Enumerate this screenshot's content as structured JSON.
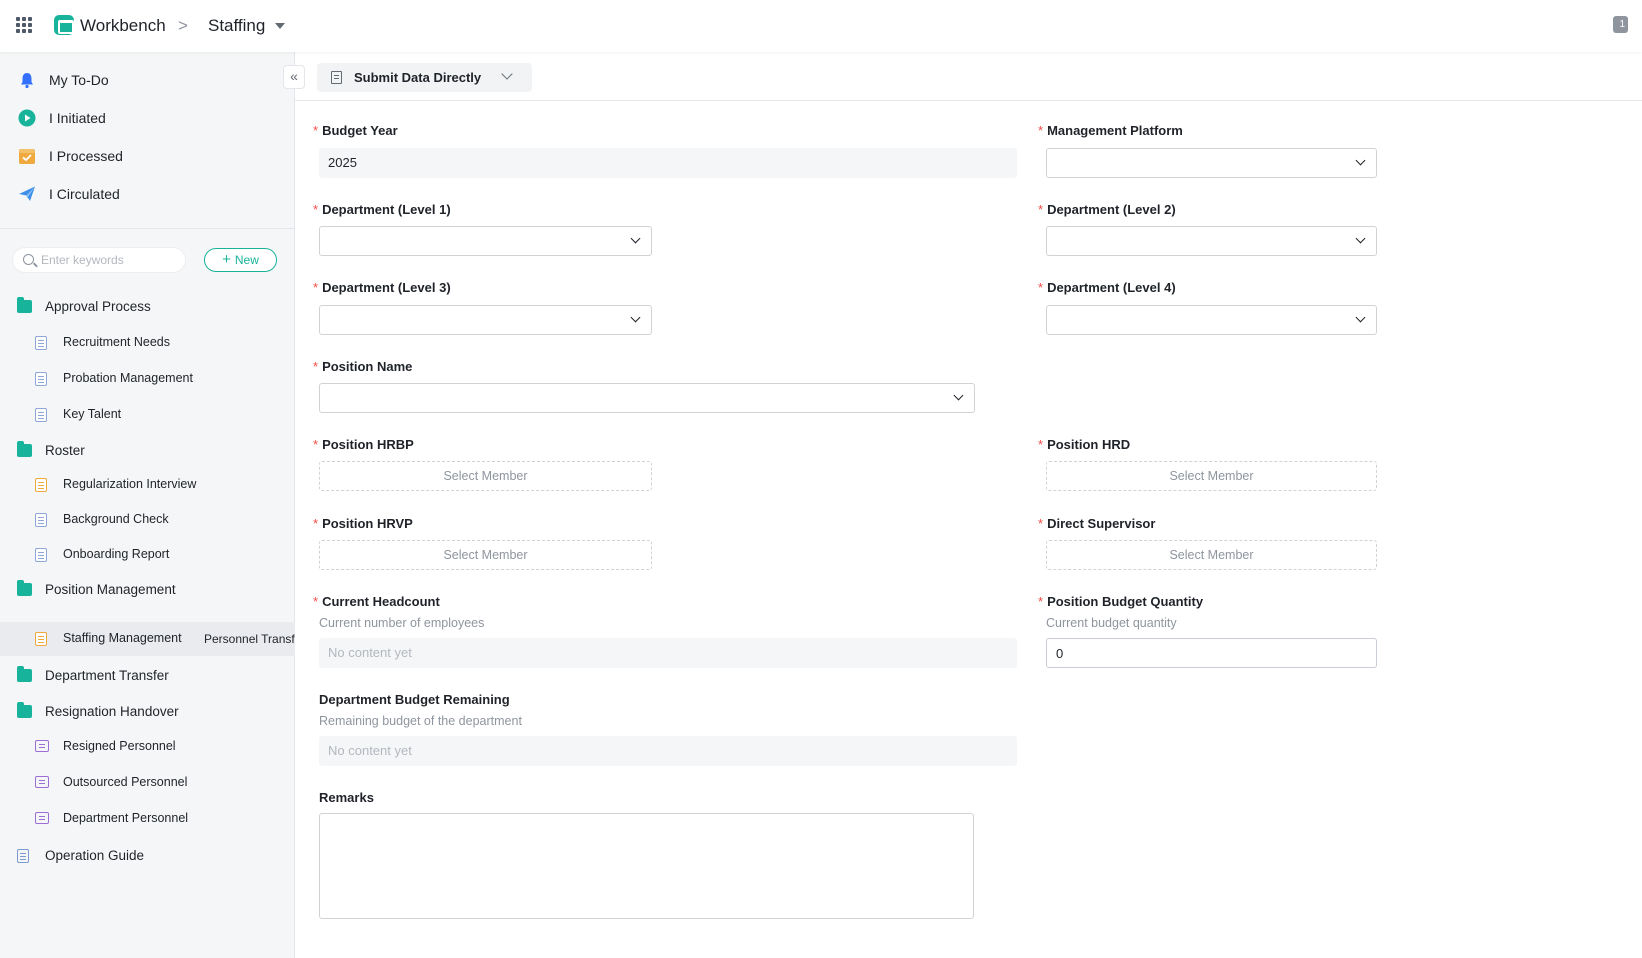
{
  "header": {
    "app_title": "Workbench",
    "breadcrumb_separator": ">",
    "current_section": "Staffing",
    "notification_count": "1"
  },
  "sidebar": {
    "quick_items": [
      {
        "label": "My To-Do",
        "icon": "bell-icon",
        "color": "#3370ff"
      },
      {
        "label": "I Initiated",
        "icon": "play-icon",
        "color": "#18b39b"
      },
      {
        "label": "I Processed",
        "icon": "checkbox-icon",
        "color": "#f0a93e"
      },
      {
        "label": "I Circulated",
        "icon": "paper-plane-icon",
        "color": "#3d8fe8"
      }
    ],
    "search_placeholder": "Enter keywords",
    "new_label": "New",
    "tree": {
      "approval_process": "Approval Process",
      "recruitment_needs": "Recruitment Needs",
      "probation_management": "Probation Management",
      "key_talent": "Key Talent",
      "roster": "Roster",
      "regularization_interview": "Regularization Interview",
      "background_check": "Background Check",
      "onboarding_report": "Onboarding Report",
      "position_management": "Position Management",
      "staffing_management": "Staffing Management",
      "staffing_management_extra": "Personnel Transfer",
      "department_transfer": "Department Transfer",
      "resignation_handover": "Resignation Handover",
      "resigned_personnel": "Resigned Personnel",
      "outsourced_personnel": "Outsourced Personnel",
      "department_personnel": "Department Personnel",
      "operation_guide": "Operation Guide"
    }
  },
  "toolbar": {
    "submit_label": "Submit Data Directly"
  },
  "form": {
    "required_mark": "*",
    "budget_year": {
      "label": "Budget Year",
      "value": "2025"
    },
    "management_platform": {
      "label": "Management Platform",
      "value": ""
    },
    "dept_level1": {
      "label": "Department (Level 1)",
      "value": ""
    },
    "dept_level2": {
      "label": "Department (Level 2)",
      "value": ""
    },
    "dept_level3": {
      "label": "Department (Level 3)",
      "value": ""
    },
    "dept_level4": {
      "label": "Department (Level 4)",
      "value": ""
    },
    "position_name": {
      "label": "Position Name",
      "value": ""
    },
    "position_hrbp": {
      "label": "Position HRBP",
      "placeholder": "Select Member"
    },
    "position_hrd": {
      "label": "Position HRD",
      "placeholder": "Select Member"
    },
    "position_hrvp": {
      "label": "Position HRVP",
      "placeholder": "Select Member"
    },
    "direct_supervisor": {
      "label": "Direct Supervisor",
      "placeholder": "Select Member"
    },
    "current_headcount": {
      "label": "Current Headcount",
      "hint": "Current number of employees",
      "empty_text": "No content yet"
    },
    "position_budget_quantity": {
      "label": "Position Budget Quantity",
      "hint": "Current budget quantity",
      "value": "0"
    },
    "dept_budget_remaining": {
      "label": "Department Budget Remaining",
      "hint": "Remaining budget of the department",
      "empty_text": "No content yet"
    },
    "remarks": {
      "label": "Remarks",
      "value": ""
    }
  },
  "colors": {
    "brand": "#18b39b",
    "required": "#f54a45",
    "active_row": "#e9ebee"
  }
}
